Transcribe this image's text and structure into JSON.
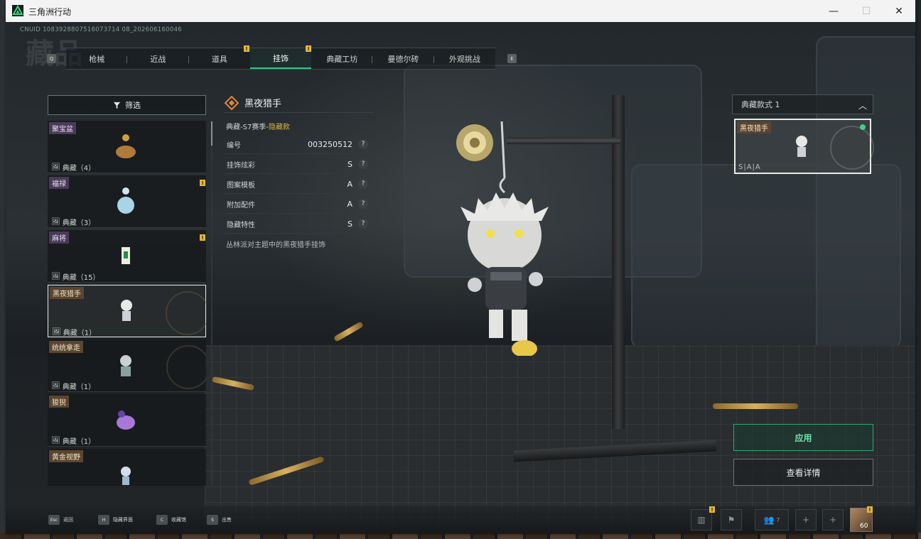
{
  "window": {
    "title": "三角洲行动",
    "minimize": "—",
    "maximize": "☐",
    "close": "✕"
  },
  "header": {
    "uid": "CNUID 1083928807516073714 08_202606160046",
    "big_title": "藏品"
  },
  "tabs": [
    {
      "label": "枪械"
    },
    {
      "label": "近战"
    },
    {
      "label": "道具"
    },
    {
      "label": "挂饰"
    },
    {
      "label": "典藏工坊"
    },
    {
      "label": "曼德尔砖"
    },
    {
      "label": "外观挑战"
    }
  ],
  "tab_keys": {
    "left": "Q",
    "right": "E"
  },
  "filter": {
    "label": "筛选"
  },
  "items": [
    {
      "name": "聚宝盆",
      "count": "典藏（4）"
    },
    {
      "name": "福禄",
      "count": "典藏（3）",
      "badge": "!"
    },
    {
      "name": "麻将",
      "count": "典藏（15）",
      "badge": "!"
    },
    {
      "name": "黑夜猎手",
      "count": "典藏（1）"
    },
    {
      "name": "统统拿走",
      "count": "典藏（1）"
    },
    {
      "name": "狻猊",
      "count": "典藏（1）"
    },
    {
      "name": "黄金视野",
      "count": ""
    }
  ],
  "detail": {
    "title": "黑夜猎手",
    "subtitle_prefix": "典藏-S7赛季-",
    "subtitle_highlight": "隐藏款",
    "attrs": [
      {
        "key": "编号",
        "value": "003250512"
      },
      {
        "key": "挂饰炫彩",
        "value": "S"
      },
      {
        "key": "图案模板",
        "value": "A"
      },
      {
        "key": "附加配件",
        "value": "A"
      },
      {
        "key": "隐藏特性",
        "value": "S"
      }
    ],
    "help": "?",
    "description": "丛林派对主题中的黑夜猎手挂饰"
  },
  "variant": {
    "header": "典藏款式 1",
    "chevron": "︿",
    "name": "黑夜猎手",
    "grade": "S|A|A",
    "accent": "#3cd08a"
  },
  "actions": {
    "apply": "应用",
    "view_details": "查看详情"
  },
  "bottom_hints": [
    {
      "key": "Esc",
      "label": "返回"
    },
    {
      "key": "H",
      "label": "隐藏界面"
    },
    {
      "key": "C",
      "label": "收藏馆"
    },
    {
      "key": "S",
      "label": "出售"
    }
  ],
  "right_icons": {
    "friends_count": "7",
    "avatar_level": "60"
  },
  "colors": {
    "accent_green": "#3cc08a",
    "badge_yellow": "#e6b53a",
    "highlight_gold": "#d9b24a"
  }
}
